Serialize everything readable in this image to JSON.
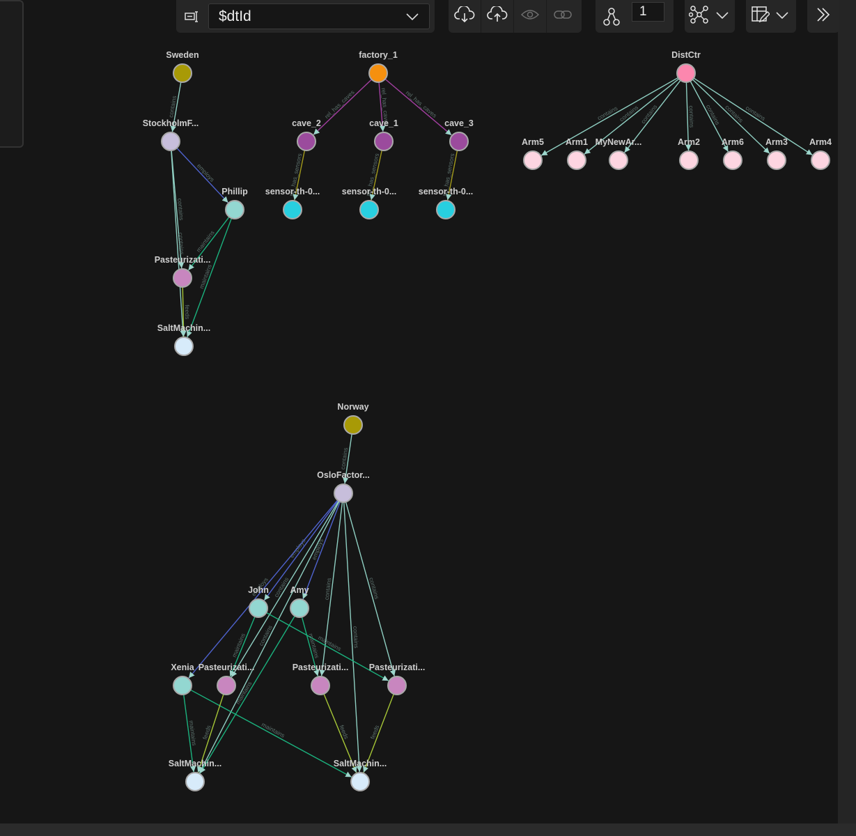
{
  "toolbar": {
    "property_select_value": "$dtId",
    "depth_value": "1"
  },
  "icons": {
    "property": "property-selector-icon",
    "import": "cloud-download-icon",
    "export": "cloud-upload-icon",
    "view": "eye-icon",
    "link": "link-icon",
    "expand": "graph-expand-icon",
    "layout": "graph-layout-icon",
    "table": "table-edit-icon",
    "collapse": "double-chevron-right-icon",
    "dropdown": "chevron-down-icon"
  },
  "colors": {
    "background": "#161616",
    "toolbar": "#262626",
    "accent_node_stroke": "#a9a9a9"
  },
  "graph": {
    "nodes": [
      {
        "id": "Sweden",
        "label": "Sweden",
        "color": "#a89a06"
      },
      {
        "id": "StockholmF",
        "label": "StockholmF...",
        "color": "#c7bedb"
      },
      {
        "id": "Phillip",
        "label": "Phillip",
        "color": "#93d7d1"
      },
      {
        "id": "PastS",
        "label": "Pasteurizati...",
        "color": "#c886bf"
      },
      {
        "id": "SaltS",
        "label": "SaltMachin...",
        "color": "#d7ebfa"
      },
      {
        "id": "factory_1",
        "label": "factory_1",
        "color": "#f5900f"
      },
      {
        "id": "cave_2",
        "label": "cave_2",
        "color": "#9b4b9d"
      },
      {
        "id": "cave_1",
        "label": "cave_1",
        "color": "#9b4b9d"
      },
      {
        "id": "cave_3",
        "label": "cave_3",
        "color": "#9b4b9d"
      },
      {
        "id": "sensor_a",
        "label": "sensor-th-0...",
        "color": "#28cfe0"
      },
      {
        "id": "sensor_b",
        "label": "sensor-th-0...",
        "color": "#28cfe0"
      },
      {
        "id": "sensor_c",
        "label": "sensor-th-0...",
        "color": "#28cfe0"
      },
      {
        "id": "DistCtr",
        "label": "DistCtr",
        "color": "#fc87ae"
      },
      {
        "id": "Arm5",
        "label": "Arm5",
        "color": "#fdd5e1"
      },
      {
        "id": "Arm1",
        "label": "Arm1",
        "color": "#fdd5e1"
      },
      {
        "id": "MyNewAr",
        "label": "MyNewAr...",
        "color": "#fdd5e1"
      },
      {
        "id": "Arm2",
        "label": "Arm2",
        "color": "#fdd5e1"
      },
      {
        "id": "Arm6",
        "label": "Arm6",
        "color": "#fdd5e1"
      },
      {
        "id": "Arm3",
        "label": "Arm3",
        "color": "#fdd5e1"
      },
      {
        "id": "Arm4",
        "label": "Arm4",
        "color": "#fdd5e1"
      },
      {
        "id": "Norway",
        "label": "Norway",
        "color": "#a89a06"
      },
      {
        "id": "OsloFactor",
        "label": "OsloFactor...",
        "color": "#c7bedb"
      },
      {
        "id": "John",
        "label": "John",
        "color": "#93d7d1"
      },
      {
        "id": "Amy",
        "label": "Amy",
        "color": "#93d7d1"
      },
      {
        "id": "Xenia",
        "label": "Xenia",
        "color": "#93d7d1"
      },
      {
        "id": "PastO1",
        "label": "Pasteurizati...",
        "color": "#c886bf"
      },
      {
        "id": "PastO2",
        "label": "Pasteurizati...",
        "color": "#c886bf"
      },
      {
        "id": "PastO3",
        "label": "Pasteurizati...",
        "color": "#c886bf"
      },
      {
        "id": "SaltO1",
        "label": "SaltMachin...",
        "color": "#d7ebfa"
      },
      {
        "id": "SaltO2",
        "label": "SaltMachin...",
        "color": "#d7ebfa"
      }
    ],
    "edges": [
      {
        "from": "Sweden",
        "to": "StockholmF",
        "label": "contains",
        "color": "#8fcfc2"
      },
      {
        "from": "StockholmF",
        "to": "Phillip",
        "label": "employs",
        "color": "#4f63cf"
      },
      {
        "from": "StockholmF",
        "to": "PastS",
        "label": "contains",
        "color": "#8fcfc2"
      },
      {
        "from": "StockholmF",
        "to": "SaltS",
        "label": "contains",
        "color": "#8fcfc2"
      },
      {
        "from": "Phillip",
        "to": "PastS",
        "label": "maintains",
        "color": "#1bb27e"
      },
      {
        "from": "Phillip",
        "to": "SaltS",
        "label": "maintains",
        "color": "#1bb27e"
      },
      {
        "from": "PastS",
        "to": "SaltS",
        "label": "feeds",
        "color": "#a6c637"
      },
      {
        "from": "factory_1",
        "to": "cave_2",
        "label": "rel_has_caves",
        "color": "#a23fa0"
      },
      {
        "from": "factory_1",
        "to": "cave_1",
        "label": "rel_has_caves",
        "color": "#a23fa0"
      },
      {
        "from": "factory_1",
        "to": "cave_3",
        "label": "rel_has_caves",
        "color": "#a23fa0"
      },
      {
        "from": "cave_2",
        "to": "sensor_a",
        "label": "rel_has_sensors",
        "color": "#a29a1c"
      },
      {
        "from": "cave_1",
        "to": "sensor_b",
        "label": "rel_has_sensors",
        "color": "#a29a1c"
      },
      {
        "from": "cave_3",
        "to": "sensor_c",
        "label": "rel_has_sensors",
        "color": "#a29a1c"
      },
      {
        "from": "DistCtr",
        "to": "Arm5",
        "label": "contains",
        "color": "#8fcfc2"
      },
      {
        "from": "DistCtr",
        "to": "Arm1",
        "label": "contains",
        "color": "#8fcfc2"
      },
      {
        "from": "DistCtr",
        "to": "MyNewAr",
        "label": "contains",
        "color": "#8fcfc2"
      },
      {
        "from": "DistCtr",
        "to": "Arm2",
        "label": "contains",
        "color": "#8fcfc2"
      },
      {
        "from": "DistCtr",
        "to": "Arm6",
        "label": "contains",
        "color": "#8fcfc2"
      },
      {
        "from": "DistCtr",
        "to": "Arm3",
        "label": "contains",
        "color": "#8fcfc2"
      },
      {
        "from": "DistCtr",
        "to": "Arm4",
        "label": "contains",
        "color": "#8fcfc2"
      },
      {
        "from": "Norway",
        "to": "OsloFactor",
        "label": "contains",
        "color": "#8fcfc2"
      },
      {
        "from": "OsloFactor",
        "to": "John",
        "label": "employs",
        "color": "#4f63cf"
      },
      {
        "from": "OsloFactor",
        "to": "Amy",
        "label": "employs",
        "color": "#4f63cf"
      },
      {
        "from": "OsloFactor",
        "to": "Xenia",
        "label": "employs",
        "color": "#4f63cf"
      },
      {
        "from": "OsloFactor",
        "to": "PastO1",
        "label": "contains",
        "color": "#8fcfc2"
      },
      {
        "from": "OsloFactor",
        "to": "PastO2",
        "label": "contains",
        "color": "#8fcfc2"
      },
      {
        "from": "OsloFactor",
        "to": "PastO3",
        "label": "contains",
        "color": "#8fcfc2"
      },
      {
        "from": "OsloFactor",
        "to": "SaltO1",
        "label": "contains",
        "color": "#8fcfc2"
      },
      {
        "from": "OsloFactor",
        "to": "SaltO2",
        "label": "contains",
        "color": "#8fcfc2"
      },
      {
        "from": "John",
        "to": "PastO1",
        "label": "maintains",
        "color": "#1bb27e"
      },
      {
        "from": "John",
        "to": "PastO3",
        "label": "maintains",
        "color": "#1bb27e"
      },
      {
        "from": "Amy",
        "to": "PastO2",
        "label": "maintains",
        "color": "#1bb27e"
      },
      {
        "from": "Amy",
        "to": "SaltO1",
        "label": "maintains",
        "color": "#1bb27e"
      },
      {
        "from": "Xenia",
        "to": "SaltO1",
        "label": "maintains",
        "color": "#1bb27e"
      },
      {
        "from": "Xenia",
        "to": "SaltO2",
        "label": "maintains",
        "color": "#1bb27e"
      },
      {
        "from": "PastO1",
        "to": "SaltO1",
        "label": "feeds",
        "color": "#a6c637"
      },
      {
        "from": "PastO2",
        "to": "SaltO2",
        "label": "feeds",
        "color": "#a6c637"
      },
      {
        "from": "PastO3",
        "to": "SaltO2",
        "label": "feeds",
        "color": "#a6c637"
      }
    ]
  }
}
